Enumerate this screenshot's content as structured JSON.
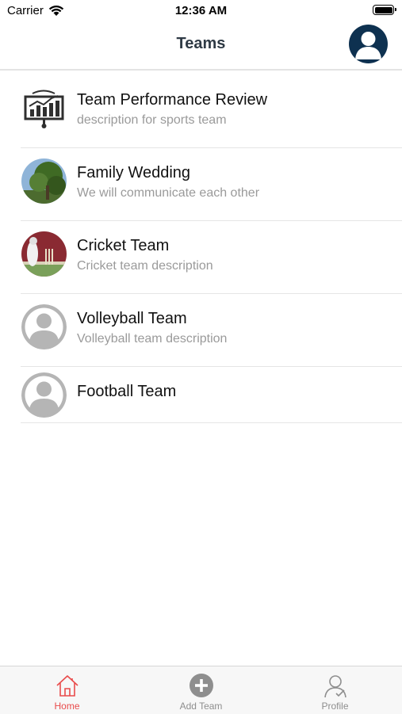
{
  "status_bar": {
    "carrier": "Carrier",
    "time": "12:36 AM"
  },
  "nav": {
    "title": "Teams",
    "avatar_icon": "user-avatar-icon"
  },
  "teams": [
    {
      "name": "Team Performance Review",
      "description": "description for sports team",
      "icon": "chart-presentation-icon"
    },
    {
      "name": "Family Wedding",
      "description": "We will communicate each other",
      "icon": "tree-photo"
    },
    {
      "name": "Cricket Team",
      "description": "Cricket team description",
      "icon": "cricket-photo"
    },
    {
      "name": "Volleyball Team",
      "description": "Volleyball team description",
      "icon": "default-avatar-icon"
    },
    {
      "name": "Football Team",
      "description": "",
      "icon": "default-avatar-icon"
    }
  ],
  "tab_bar": {
    "tabs": [
      {
        "label": "Home",
        "icon": "home-icon",
        "active": true
      },
      {
        "label": "Add Team",
        "icon": "plus-circle-icon",
        "active": false
      },
      {
        "label": "Profile",
        "icon": "profile-icon",
        "active": false
      }
    ]
  },
  "colors": {
    "accent": "#e94b4b",
    "nav_avatar_bg": "#0e3150",
    "title_text": "#2f3a45",
    "secondary_text": "#9a9a9a",
    "placeholder_avatar": "#b5b5b5"
  }
}
